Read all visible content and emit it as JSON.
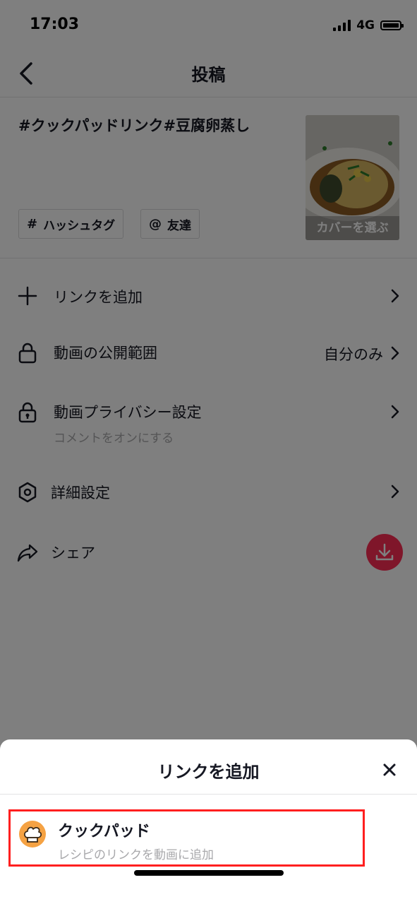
{
  "status_bar": {
    "time": "17:03",
    "network": "4G"
  },
  "header": {
    "title": "投稿",
    "back_icon": "chevron-left-icon"
  },
  "caption": {
    "text": "#クックパッドリンク#豆腐卵蒸し"
  },
  "chips": [
    {
      "symbol": "#",
      "label": "ハッシュタグ"
    },
    {
      "symbol": "@",
      "label": "友達"
    }
  ],
  "cover": {
    "label": "カバーを選ぶ"
  },
  "settings": {
    "add_link": {
      "label": "リンクを追加",
      "icon": "plus-icon"
    },
    "visibility": {
      "label": "動画の公開範囲",
      "value": "自分のみ",
      "icon": "lock-open-icon"
    },
    "privacy": {
      "label": "動画プライバシー設定",
      "sublabel": "コメントをオンにする",
      "icon": "lock-icon"
    },
    "advanced": {
      "label": "詳細設定",
      "icon": "gear-icon"
    },
    "share": {
      "label": "シェア",
      "icon": "share-icon"
    }
  },
  "download_button": {
    "icon": "download-icon",
    "color": "#fe2c55"
  },
  "sheet": {
    "title": "リンクを追加",
    "close_icon": "close-icon",
    "options": [
      {
        "title": "クックパッド",
        "subtitle": "レシピのリンクを動画に追加",
        "icon": "chef-hat-icon",
        "icon_color": "#f5a243"
      }
    ]
  },
  "highlight_color": "#ff1f1f"
}
